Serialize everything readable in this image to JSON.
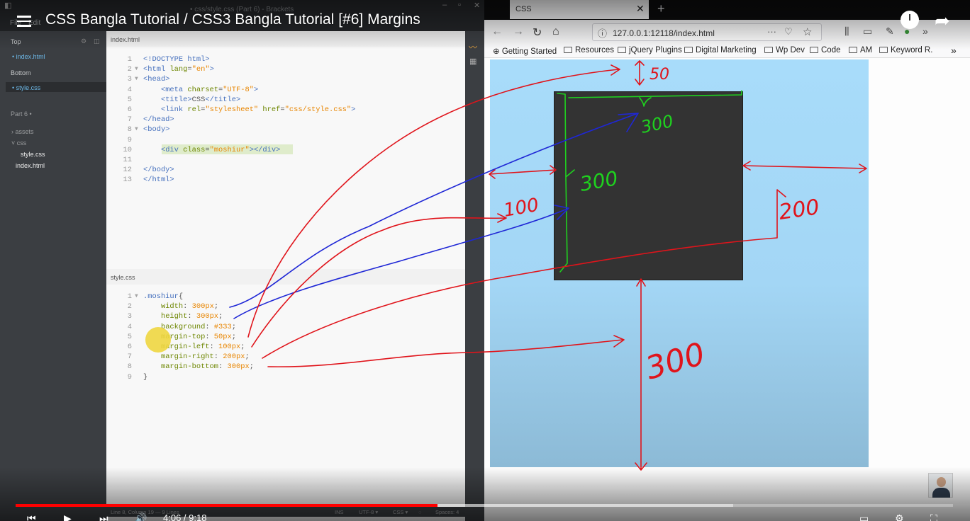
{
  "brackets": {
    "window_title": "• css/style.css (Part 6) - Brackets",
    "menu_file": "File",
    "menu_edit": "Edit",
    "sidebar": {
      "top_label": "Top",
      "working_top": "index.html",
      "bottom_label": "Bottom",
      "working_bottom": "style.css",
      "project": "Part 6 •",
      "tree": [
        "assets",
        "css",
        "style.css",
        "index.html"
      ]
    },
    "tab_top": "index.html",
    "tab_bottom": "style.css",
    "html_lines": [
      {
        "n": "1",
        "fold": "",
        "parts": [
          {
            "c": "tg",
            "t": "<!DOCTYPE html>"
          }
        ]
      },
      {
        "n": "2",
        "fold": "▼",
        "parts": [
          {
            "c": "tg",
            "t": "<html "
          },
          {
            "c": "at",
            "t": "lang"
          },
          {
            "c": "",
            "t": "="
          },
          {
            "c": "vl",
            "t": "\"en\""
          },
          {
            "c": "tg",
            "t": ">"
          }
        ]
      },
      {
        "n": "3",
        "fold": "▼",
        "parts": [
          {
            "c": "tg",
            "t": "<head>"
          }
        ]
      },
      {
        "n": "4",
        "fold": "",
        "parts": [
          {
            "c": "",
            "t": "    "
          },
          {
            "c": "tg",
            "t": "<meta "
          },
          {
            "c": "at",
            "t": "charset"
          },
          {
            "c": "",
            "t": "="
          },
          {
            "c": "vl",
            "t": "\"UTF-8\""
          },
          {
            "c": "tg",
            "t": ">"
          }
        ]
      },
      {
        "n": "5",
        "fold": "",
        "parts": [
          {
            "c": "",
            "t": "    "
          },
          {
            "c": "tg",
            "t": "<title>"
          },
          {
            "c": "",
            "t": "CSS"
          },
          {
            "c": "tg",
            "t": "</title>"
          }
        ]
      },
      {
        "n": "6",
        "fold": "",
        "parts": [
          {
            "c": "",
            "t": "    "
          },
          {
            "c": "tg",
            "t": "<link "
          },
          {
            "c": "at",
            "t": "rel"
          },
          {
            "c": "",
            "t": "="
          },
          {
            "c": "vl",
            "t": "\"stylesheet\""
          },
          {
            "c": "",
            "t": " "
          },
          {
            "c": "at",
            "t": "href"
          },
          {
            "c": "",
            "t": "="
          },
          {
            "c": "vl",
            "t": "\"css/style.css\""
          },
          {
            "c": "tg",
            "t": ">"
          }
        ]
      },
      {
        "n": "7",
        "fold": "",
        "parts": [
          {
            "c": "tg",
            "t": "</head>"
          }
        ]
      },
      {
        "n": "8",
        "fold": "▼",
        "parts": [
          {
            "c": "tg",
            "t": "<body>"
          }
        ]
      },
      {
        "n": "9",
        "fold": "",
        "parts": []
      },
      {
        "n": "10",
        "fold": "",
        "parts": [
          {
            "c": "",
            "t": "    "
          },
          {
            "c": "tg",
            "t": "<div "
          },
          {
            "c": "at",
            "t": "class"
          },
          {
            "c": "",
            "t": "="
          },
          {
            "c": "vl",
            "t": "\"moshiur\""
          },
          {
            "c": "tg",
            "t": "></div>"
          }
        ]
      },
      {
        "n": "11",
        "fold": "",
        "parts": []
      },
      {
        "n": "12",
        "fold": "",
        "parts": [
          {
            "c": "tg",
            "t": "</body>"
          }
        ]
      },
      {
        "n": "13",
        "fold": "",
        "parts": [
          {
            "c": "tg",
            "t": "</html>"
          }
        ]
      }
    ],
    "css_lines": [
      {
        "n": "1",
        "fold": "▼",
        "parts": [
          {
            "c": "ky",
            "t": ".moshiur"
          },
          {
            "c": "",
            "t": "{"
          }
        ]
      },
      {
        "n": "2",
        "fold": "",
        "parts": [
          {
            "c": "",
            "t": "    "
          },
          {
            "c": "pr",
            "t": "width"
          },
          {
            "c": "",
            "t": ": "
          },
          {
            "c": "vl",
            "t": "300px"
          },
          {
            "c": "",
            "t": ";"
          }
        ]
      },
      {
        "n": "3",
        "fold": "",
        "parts": [
          {
            "c": "",
            "t": "    "
          },
          {
            "c": "pr",
            "t": "height"
          },
          {
            "c": "",
            "t": ": "
          },
          {
            "c": "vl",
            "t": "300px"
          },
          {
            "c": "",
            "t": ";"
          }
        ]
      },
      {
        "n": "4",
        "fold": "",
        "parts": [
          {
            "c": "",
            "t": "    "
          },
          {
            "c": "pr",
            "t": "background"
          },
          {
            "c": "",
            "t": ": "
          },
          {
            "c": "vl",
            "t": "#333"
          },
          {
            "c": "",
            "t": ";"
          }
        ]
      },
      {
        "n": "5",
        "fold": "",
        "parts": [
          {
            "c": "",
            "t": "    "
          },
          {
            "c": "pr",
            "t": "margin-top"
          },
          {
            "c": "",
            "t": ": "
          },
          {
            "c": "vl",
            "t": "50px"
          },
          {
            "c": "",
            "t": ";"
          }
        ]
      },
      {
        "n": "6",
        "fold": "",
        "parts": [
          {
            "c": "",
            "t": "    "
          },
          {
            "c": "pr",
            "t": "margin-left"
          },
          {
            "c": "",
            "t": ": "
          },
          {
            "c": "vl",
            "t": "100px"
          },
          {
            "c": "",
            "t": ";"
          }
        ]
      },
      {
        "n": "7",
        "fold": "",
        "parts": [
          {
            "c": "",
            "t": "    "
          },
          {
            "c": "pr",
            "t": "margin-right"
          },
          {
            "c": "",
            "t": ": "
          },
          {
            "c": "vl",
            "t": "200px"
          },
          {
            "c": "",
            "t": ";"
          }
        ]
      },
      {
        "n": "8",
        "fold": "",
        "parts": [
          {
            "c": "",
            "t": "    "
          },
          {
            "c": "pr",
            "t": "margin-bottom"
          },
          {
            "c": "",
            "t": ": "
          },
          {
            "c": "vl",
            "t": "300px"
          },
          {
            "c": "",
            "t": ";"
          }
        ]
      },
      {
        "n": "9",
        "fold": "",
        "parts": [
          {
            "c": "",
            "t": "}"
          }
        ]
      }
    ],
    "status": {
      "position": "Line 8, Column 19 — 9 Lines",
      "mode": "INS",
      "encoding": "UTF-8 ▾",
      "language": "CSS ▾",
      "spaces": "Spaces: 4"
    }
  },
  "firefox": {
    "tab_title": "CSS",
    "url": "127.0.0.1:12118/index.html",
    "bookmarks": [
      "Getting Started",
      "Resources",
      "jQuery Plugins",
      "Digital Marketing",
      "Wp Dev",
      "Code",
      "AM",
      "Keyword R."
    ],
    "colors": {
      "box": "#333333",
      "body": "#a8dcfa"
    }
  },
  "youtube": {
    "title": "CSS Bangla Tutorial / CSS3 Bangla Tutorial [#6] Margins",
    "time": "4:06 / 9:18",
    "played_fraction": 0.4501,
    "buffered_fraction": 0.7655
  },
  "annotations": {
    "top": "50",
    "width": "300",
    "height": "300",
    "left": "100",
    "right": "200",
    "bottom": "300"
  }
}
